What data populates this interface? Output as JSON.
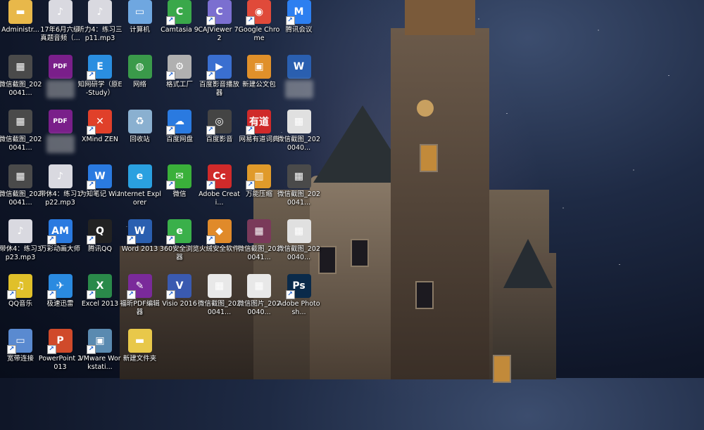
{
  "desktop": {
    "icons": [
      {
        "label": "Administr...",
        "icon": "folder-icon",
        "color": "#e8b84a",
        "glyph": "▬",
        "shortcut": false,
        "hidden_label": false
      },
      {
        "label": "17年6月六级真题音频（...",
        "icon": "mp3-file-icon",
        "color": "#d9d9e0",
        "glyph": "♪",
        "shortcut": false,
        "hidden_label": false
      },
      {
        "label": "听力4：练习三p11.mp3",
        "icon": "mp3-file-icon",
        "color": "#d9d9e0",
        "glyph": "♪",
        "shortcut": false,
        "hidden_label": false
      },
      {
        "label": "计算机",
        "icon": "computer-icon",
        "color": "#6fa7e0",
        "glyph": "▭",
        "shortcut": false,
        "hidden_label": false
      },
      {
        "label": "Camtasia 9",
        "icon": "camtasia-icon",
        "color": "#3aa84a",
        "glyph": "C",
        "shortcut": true,
        "hidden_label": false
      },
      {
        "label": "CAJViewer 7.2",
        "icon": "cajviewer-icon",
        "color": "#7b6fd0",
        "glyph": "C",
        "shortcut": true,
        "hidden_label": false
      },
      {
        "label": "Google Chrome",
        "icon": "chrome-icon",
        "color": "#e04a3a",
        "glyph": "◉",
        "shortcut": true,
        "hidden_label": false
      },
      {
        "label": "腾讯会议",
        "icon": "tencent-meeting-icon",
        "color": "#2d7ff0",
        "glyph": "M",
        "shortcut": true,
        "hidden_label": false
      },
      {
        "label": "微信截图_2020041...",
        "icon": "image-file-icon",
        "color": "#4a4a4a",
        "glyph": "▦",
        "shortcut": false,
        "hidden_label": false
      },
      {
        "label": "",
        "icon": "pdf-file-icon",
        "color": "#7a1f8a",
        "glyph": "PDF",
        "shortcut": false,
        "hidden_label": true
      },
      {
        "label": "知网研学（原E-Study）",
        "icon": "cnki-estudy-icon",
        "color": "#2a8ee0",
        "glyph": "E",
        "shortcut": true,
        "hidden_label": false
      },
      {
        "label": "网络",
        "icon": "network-icon",
        "color": "#3a9a4a",
        "glyph": "◍",
        "shortcut": false,
        "hidden_label": false
      },
      {
        "label": "格式工厂",
        "icon": "format-factory-icon",
        "color": "#b0b0b0",
        "glyph": "⚙",
        "shortcut": true,
        "hidden_label": false
      },
      {
        "label": "百度影音播放器",
        "icon": "baidu-player-icon",
        "color": "#3a6fd0",
        "glyph": "▶",
        "shortcut": true,
        "hidden_label": false
      },
      {
        "label": "新建公文包",
        "icon": "briefcase-icon",
        "color": "#e0902a",
        "glyph": "▣",
        "shortcut": false,
        "hidden_label": false
      },
      {
        "label": "",
        "icon": "word-file-icon",
        "color": "#2a5fb0",
        "glyph": "W",
        "shortcut": false,
        "hidden_label": true
      },
      {
        "label": "微信截图_2020041...",
        "icon": "image-file-icon",
        "color": "#4a4a4a",
        "glyph": "▦",
        "shortcut": false,
        "hidden_label": false
      },
      {
        "label": "",
        "icon": "pdf-file-icon",
        "color": "#7a1f8a",
        "glyph": "PDF",
        "shortcut": false,
        "hidden_label": true
      },
      {
        "label": "XMind ZEN",
        "icon": "xmind-icon",
        "color": "#e0402a",
        "glyph": "✕",
        "shortcut": true,
        "hidden_label": false
      },
      {
        "label": "回收站",
        "icon": "recycle-bin-icon",
        "color": "#8ab0d0",
        "glyph": "♻",
        "shortcut": false,
        "hidden_label": false
      },
      {
        "label": "百度网盘",
        "icon": "baidu-netdisk-icon",
        "color": "#2a7ae0",
        "glyph": "☁",
        "shortcut": true,
        "hidden_label": false
      },
      {
        "label": "百度影音",
        "icon": "baidu-video-icon",
        "color": "#444",
        "glyph": "◎",
        "shortcut": true,
        "hidden_label": false
      },
      {
        "label": "网易有道词典",
        "icon": "youdao-icon",
        "color": "#d02a2a",
        "glyph": "有道",
        "shortcut": true,
        "hidden_label": false
      },
      {
        "label": "微信截图_2020040...",
        "icon": "image-file-icon",
        "color": "#e0e0e0",
        "glyph": "▦",
        "shortcut": false,
        "hidden_label": false
      },
      {
        "label": "微信截图_2020041...",
        "icon": "image-file-icon",
        "color": "#4a4a4a",
        "glyph": "▦",
        "shortcut": false,
        "hidden_label": false
      },
      {
        "label": "带休4：练习1 p22.mp3",
        "icon": "mp3-file-icon",
        "color": "#d9d9e0",
        "glyph": "♪",
        "shortcut": false,
        "hidden_label": false
      },
      {
        "label": "为知笔记 Wiz",
        "icon": "wiz-notes-icon",
        "color": "#2a7ae0",
        "glyph": "W",
        "shortcut": true,
        "hidden_label": false
      },
      {
        "label": "Internet Explorer",
        "icon": "ie-icon",
        "color": "#2aa0e0",
        "glyph": "e",
        "shortcut": false,
        "hidden_label": false
      },
      {
        "label": "微信",
        "icon": "wechat-icon",
        "color": "#3ab03a",
        "glyph": "✉",
        "shortcut": true,
        "hidden_label": false
      },
      {
        "label": "Adobe Creati...",
        "icon": "adobe-cc-icon",
        "color": "#d02a2a",
        "glyph": "Cc",
        "shortcut": true,
        "hidden_label": false
      },
      {
        "label": "万能压缩",
        "icon": "compress-icon",
        "color": "#e09a2a",
        "glyph": "▥",
        "shortcut": true,
        "hidden_label": false
      },
      {
        "label": "微信截图_2020041...",
        "icon": "image-file-icon",
        "color": "#4a4a4a",
        "glyph": "▦",
        "shortcut": false,
        "hidden_label": false
      },
      {
        "label": "带休4：练习3 p23.mp3",
        "icon": "mp3-file-icon",
        "color": "#d9d9e0",
        "glyph": "♪",
        "shortcut": false,
        "hidden_label": false
      },
      {
        "label": "万彩动画大师",
        "icon": "animation-icon",
        "color": "#2a7ae0",
        "glyph": "AM",
        "shortcut": true,
        "hidden_label": false
      },
      {
        "label": "腾讯QQ",
        "icon": "qq-icon",
        "color": "#222",
        "glyph": "Q",
        "shortcut": true,
        "hidden_label": false
      },
      {
        "label": "Word 2013",
        "icon": "word-icon",
        "color": "#2a5fb0",
        "glyph": "W",
        "shortcut": true,
        "hidden_label": false
      },
      {
        "label": "360安全浏览器",
        "icon": "browser-360-icon",
        "color": "#3ab04a",
        "glyph": "e",
        "shortcut": true,
        "hidden_label": false
      },
      {
        "label": "火绒安全软件",
        "icon": "huorong-icon",
        "color": "#e08a2a",
        "glyph": "◆",
        "shortcut": true,
        "hidden_label": false
      },
      {
        "label": "微信截图_2020041...",
        "icon": "image-file-icon",
        "color": "#7a3a5a",
        "glyph": "▦",
        "shortcut": false,
        "hidden_label": false
      },
      {
        "label": "微信截图_2020040...",
        "icon": "image-file-icon",
        "color": "#e0e0e0",
        "glyph": "▦",
        "shortcut": false,
        "hidden_label": false
      },
      {
        "label": "QQ音乐",
        "icon": "qq-music-icon",
        "color": "#e0c02a",
        "glyph": "♫",
        "shortcut": true,
        "hidden_label": false
      },
      {
        "label": "极速迅雷",
        "icon": "xunlei-icon",
        "color": "#2a8ae0",
        "glyph": "✈",
        "shortcut": true,
        "hidden_label": false
      },
      {
        "label": "Excel 2013",
        "icon": "excel-icon",
        "color": "#2a8a4a",
        "glyph": "X",
        "shortcut": true,
        "hidden_label": false
      },
      {
        "label": "福昕PDF编辑器",
        "icon": "foxit-pdf-icon",
        "color": "#7a2a9a",
        "glyph": "✎",
        "shortcut": true,
        "hidden_label": false
      },
      {
        "label": "Visio 2016",
        "icon": "visio-icon",
        "color": "#3a5ab0",
        "glyph": "V",
        "shortcut": true,
        "hidden_label": false
      },
      {
        "label": "微信截图_2020041...",
        "icon": "image-file-icon",
        "color": "#e8e8e8",
        "glyph": "▦",
        "shortcut": false,
        "hidden_label": false
      },
      {
        "label": "微信图片_2020040...",
        "icon": "image-file-icon",
        "color": "#e8e8e8",
        "glyph": "▦",
        "shortcut": false,
        "hidden_label": false
      },
      {
        "label": "Adobe Photosh...",
        "icon": "photoshop-icon",
        "color": "#0a2a4a",
        "glyph": "Ps",
        "shortcut": true,
        "hidden_label": false
      },
      {
        "label": "宽带连接",
        "icon": "broadband-icon",
        "color": "#5a8ad0",
        "glyph": "▭",
        "shortcut": true,
        "hidden_label": false
      },
      {
        "label": "PowerPoint 2013",
        "icon": "powerpoint-icon",
        "color": "#d04a2a",
        "glyph": "P",
        "shortcut": true,
        "hidden_label": false
      },
      {
        "label": "VMware Workstati...",
        "icon": "vmware-icon",
        "color": "#5a8ab0",
        "glyph": "▣",
        "shortcut": true,
        "hidden_label": false
      },
      {
        "label": "新建文件夹",
        "icon": "folder-icon",
        "color": "#e8c84a",
        "glyph": "▬",
        "shortcut": false,
        "hidden_label": false
      }
    ]
  }
}
